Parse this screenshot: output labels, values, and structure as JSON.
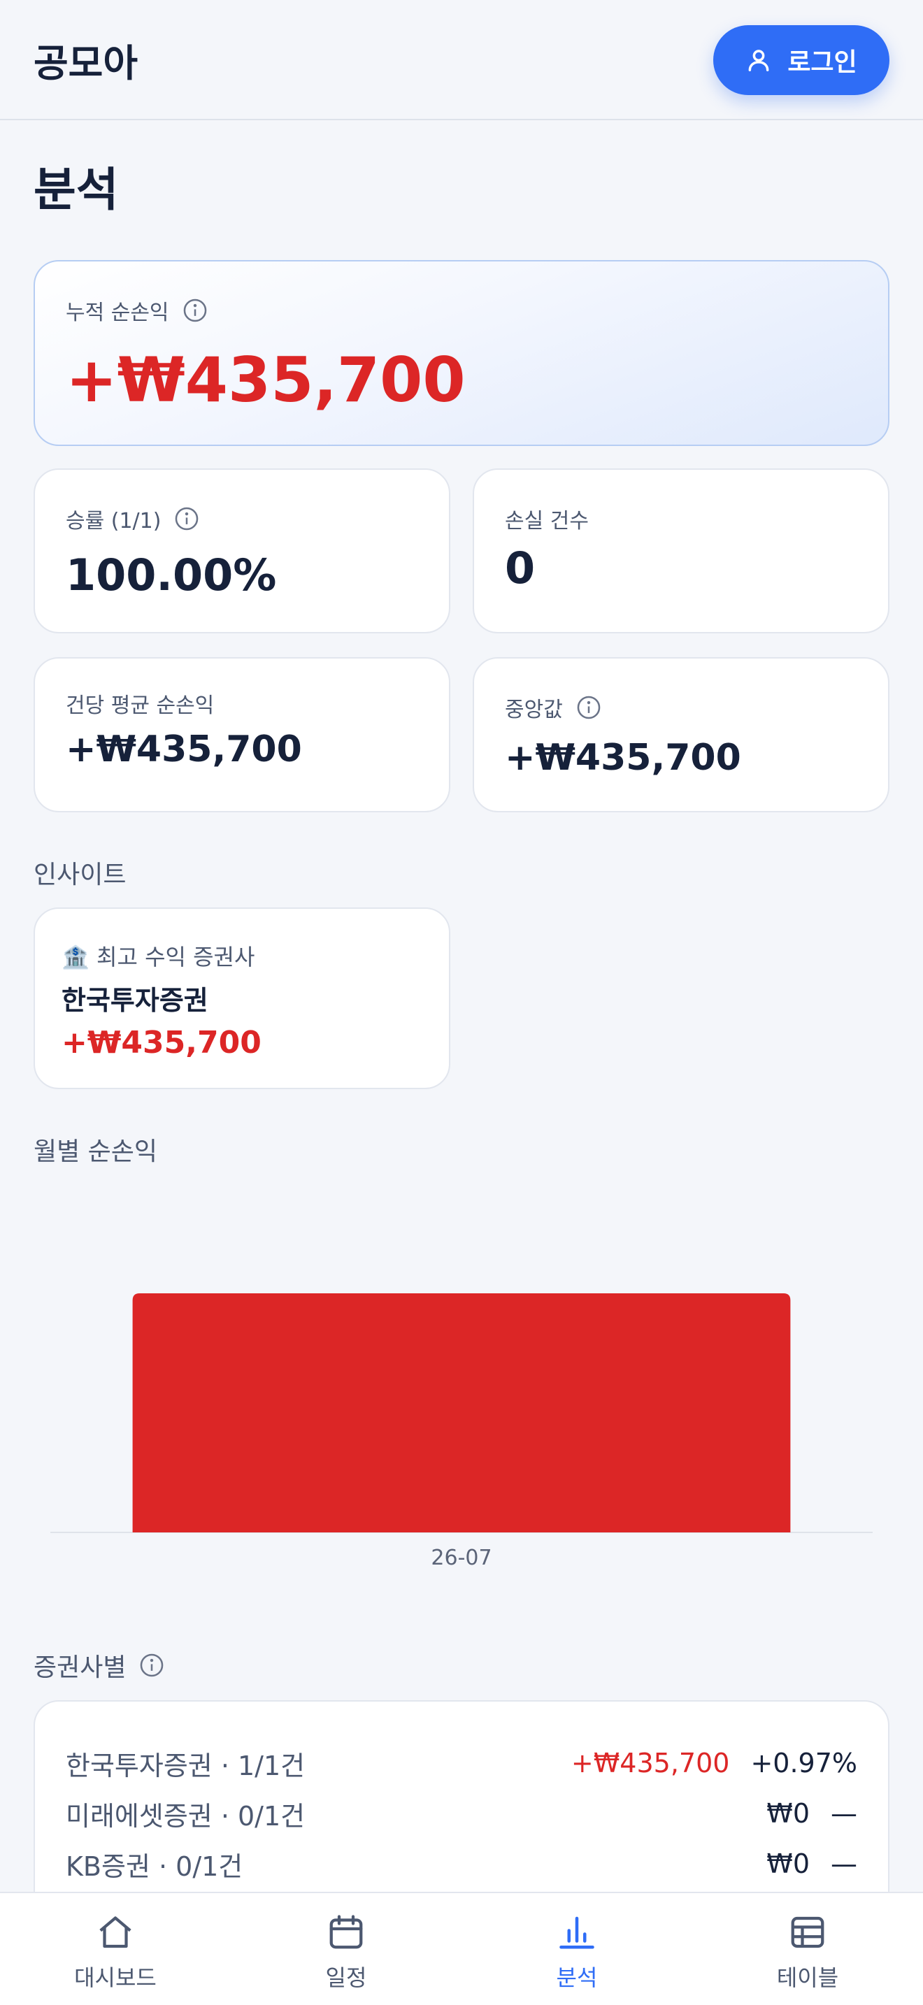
{
  "header": {
    "app_title": "공모아",
    "login_label": "로그인"
  },
  "page": {
    "title": "분석"
  },
  "cumulative": {
    "label": "누적 순손익",
    "value": "+₩435,700"
  },
  "win_rate": {
    "label": "승률 (1/1)",
    "value": "100.00%"
  },
  "loss_count": {
    "label": "손실 건수",
    "value": "0"
  },
  "avg_per_trade": {
    "label": "건당 평균 순손익",
    "value": "+₩435,700"
  },
  "median": {
    "label": "중앙값",
    "value": "+₩435,700"
  },
  "insights": {
    "title": "인사이트",
    "top_broker": {
      "label": "최고 수익 증권사",
      "broker": "한국투자증권",
      "value": "+₩435,700"
    }
  },
  "monthly": {
    "title": "월별 순손익",
    "chart_data": {
      "type": "bar",
      "categories": [
        "26-07"
      ],
      "values": [
        435700
      ],
      "bar_color": "#dc2626"
    }
  },
  "by_broker": {
    "title": "증권사별",
    "rows": [
      {
        "name": "한국투자증권 · 1/1건",
        "amount": "+₩435,700",
        "pct": "+0.97%"
      },
      {
        "name": "미래에셋증권 · 0/1건",
        "amount": "₩0",
        "pct": "—"
      },
      {
        "name": "KB증권 · 0/1건",
        "amount": "₩0",
        "pct": "—"
      }
    ]
  },
  "nav": {
    "items": [
      {
        "label": "대시보드",
        "icon": "home-icon"
      },
      {
        "label": "일정",
        "icon": "calendar-icon"
      },
      {
        "label": "분석",
        "icon": "bar-chart-icon"
      },
      {
        "label": "테이블",
        "icon": "table-icon"
      }
    ],
    "active_color": "#2f6df6"
  },
  "colors": {
    "accent": "#2f6df6",
    "positive": "#dc2626"
  }
}
